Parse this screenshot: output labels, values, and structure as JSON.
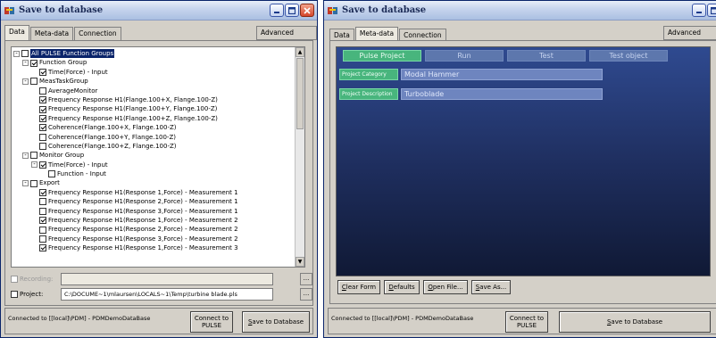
{
  "left_window": {
    "title": "Save to database",
    "tabs": [
      "Data",
      "Meta-data",
      "Connection"
    ],
    "active_tab": "Data",
    "advanced_button": "Advanced mode",
    "tree": [
      {
        "label": "All PULSE Function Groups",
        "level": 0,
        "exp": "-",
        "checked": false
      },
      {
        "label": "Function Group",
        "level": 1,
        "exp": "-",
        "checked": true
      },
      {
        "label": "Time(Force) - Input",
        "level": 2,
        "exp": "",
        "checked": true
      },
      {
        "label": "MeasTaskGroup",
        "level": 1,
        "exp": "-",
        "checked": false
      },
      {
        "label": "AverageMonitor",
        "level": 2,
        "exp": "",
        "checked": false
      },
      {
        "label": "Frequency Response H1(Flange.100+X, Flange.100-Z)",
        "level": 2,
        "exp": "",
        "checked": true
      },
      {
        "label": "Frequency Response H1(Flange.100+Y, Flange.100-Z)",
        "level": 2,
        "exp": "",
        "checked": true
      },
      {
        "label": "Frequency Response H1(Flange.100+Z, Flange.100-Z)",
        "level": 2,
        "exp": "",
        "checked": true
      },
      {
        "label": "Coherence(Flange.100+X, Flange.100-Z)",
        "level": 2,
        "exp": "",
        "checked": true
      },
      {
        "label": "Coherence(Flange.100+Y, Flange.100-Z)",
        "level": 2,
        "exp": "",
        "checked": false
      },
      {
        "label": "Coherence(Flange.100+Z, Flange.100-Z)",
        "level": 2,
        "exp": "",
        "checked": false
      },
      {
        "label": "Monitor Group",
        "level": 1,
        "exp": "-",
        "checked": false
      },
      {
        "label": "Time(Force) - Input",
        "level": 2,
        "exp": "-",
        "checked": true
      },
      {
        "label": "Function - Input",
        "level": 3,
        "exp": "",
        "checked": false
      },
      {
        "label": "Export",
        "level": 1,
        "exp": "-",
        "checked": false
      },
      {
        "label": "Frequency Response H1(Response 1,Force) - Measurement 1",
        "level": 2,
        "exp": "",
        "checked": true
      },
      {
        "label": "Frequency Response H1(Response 2,Force) - Measurement 1",
        "level": 2,
        "exp": "",
        "checked": false
      },
      {
        "label": "Frequency Response H1(Response 3,Force) - Measurement 1",
        "level": 2,
        "exp": "",
        "checked": false
      },
      {
        "label": "Frequency Response H1(Response 1,Force) - Measurement 2",
        "level": 2,
        "exp": "",
        "checked": true
      },
      {
        "label": "Frequency Response H1(Response 2,Force) - Measurement 2",
        "level": 2,
        "exp": "",
        "checked": false
      },
      {
        "label": "Frequency Response H1(Response 3,Force) - Measurement 2",
        "level": 2,
        "exp": "",
        "checked": false
      },
      {
        "label": "Frequency Response H1(Response 1,Force) - Measurement 3",
        "level": 2,
        "exp": "",
        "checked": true
      }
    ],
    "recording_label": "Recording:",
    "recording_value": "",
    "project_label": "Project:",
    "project_value": "C:\\DOCUME~1\\mlaursen\\LOCALS~1\\Temp\\turbine blade.pls",
    "ellipsis": "...",
    "status": "Connected to [[local]\\PDM] - PDMDemoDataBase",
    "connect_button": [
      "Connect to",
      "PULSE"
    ],
    "save_button": "Save to Database",
    "save_hotkey": "S",
    "save_rest": "ave to Database"
  },
  "right_window": {
    "title": "Save to database",
    "tabs": [
      "Data",
      "Meta-data",
      "Connection"
    ],
    "active_tab": "Meta-data",
    "advanced_button": "Advanced mode",
    "meta_tabs": [
      "Pulse Project",
      "Run",
      "Test",
      "Test object"
    ],
    "active_meta_tab": "Pulse Project",
    "fields": [
      {
        "label": "Project Category",
        "value": "Modal Hammer"
      },
      {
        "label": "Project Description",
        "value": "Turboblade"
      }
    ],
    "buttons": {
      "clear_hotkey": "C",
      "clear_rest": "lear Form",
      "defaults_hotkey": "D",
      "defaults_rest": "efaults",
      "open_hotkey": "O",
      "open_rest": "pen File...",
      "saveas_hotkey": "S",
      "saveas_rest": "ave As..."
    },
    "status": "Connected to [[local]\\PDM] - PDMDemoDataBase",
    "connect_button": [
      "Connect to",
      "PULSE"
    ],
    "save_hotkey": "S",
    "save_rest": "ave to Database"
  },
  "colors": {
    "title_text": "#1b2a55",
    "panel_dark": "#1f2f60",
    "tab_active_green": "#48b57d",
    "tab_inactive_blue": "#5d77ad"
  }
}
